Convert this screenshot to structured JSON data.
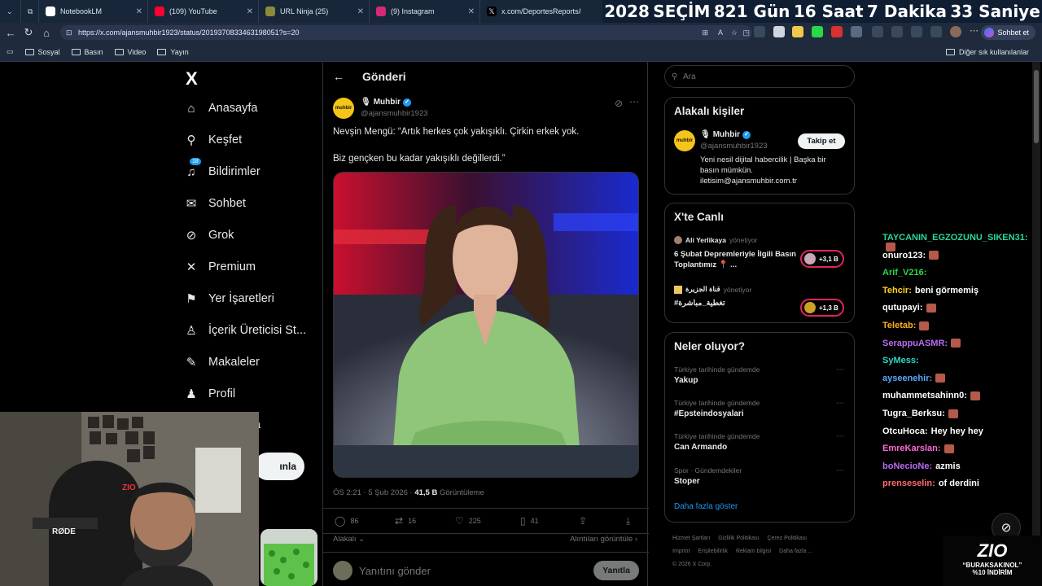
{
  "browser": {
    "tabs": [
      {
        "title": "NotebookLM",
        "color": "#ffffff"
      },
      {
        "title": "(109) YouTube",
        "color": "#ff0033"
      },
      {
        "title": "URL Ninja (25)",
        "color": "#8a8a3a"
      },
      {
        "title": "(9) Instagram",
        "color": "#d62976"
      },
      {
        "title": "x.com/DeportesReports/sta",
        "color": "#000000"
      }
    ],
    "url": "https://x.com/ajansmuhbir1923/status/2019370833463198051?s=20",
    "chat_button": "Sohbet et",
    "bookmarks": [
      "Sosyal",
      "Basın",
      "Video",
      "Yayın"
    ],
    "other_bookmarks": "Diğer sık kullanılanlar"
  },
  "countdown": {
    "year": "2028",
    "label": "SEÇİM",
    "days": "821 Gün",
    "hours": "16 Saat",
    "minutes": "7 Dakika",
    "seconds": "33 Saniye"
  },
  "sidebar": {
    "logo": "X",
    "items": [
      {
        "label": "Anasayfa",
        "icon": "home-icon"
      },
      {
        "label": "Keşfet",
        "icon": "search-icon"
      },
      {
        "label": "Bildirimler",
        "icon": "bell-icon",
        "badge": "18"
      },
      {
        "label": "Sohbet",
        "icon": "mail-icon"
      },
      {
        "label": "Grok",
        "icon": "grok-icon"
      },
      {
        "label": "Premium",
        "icon": "x-icon"
      },
      {
        "label": "Yer İşaretleri",
        "icon": "bookmark-icon"
      },
      {
        "label": "İçerik Üreticisi St...",
        "icon": "creator-icon"
      },
      {
        "label": "Makaleler",
        "icon": "article-icon"
      },
      {
        "label": "Profil",
        "icon": "person-icon"
      }
    ],
    "post_button": "ınla",
    "partial_item": "a"
  },
  "post": {
    "header": "Gönderi",
    "author_name": "Muhbir",
    "author_handle": "@ajansmuhbir1923",
    "avatar_text": "muhbir",
    "text_line1": "Nevşin Mengü: “Artık herkes çok yakışıklı. Çirkin erkek yok.",
    "text_line2": "Biz gençken bu kadar yakışıklı değillerdi.”",
    "timestamp": "ÖS 2:21 · 5 Şub 2026 ·",
    "views_count": "41,5 B",
    "views_label": "Görüntüleme",
    "replies": "86",
    "reposts": "16",
    "likes": "225",
    "bookmarks": "41",
    "related_label": "Alakalı",
    "quotes_label": "Alıntıları görüntüle",
    "reply_placeholder": "Yanıtını gönder",
    "reply_button": "Yanıtla"
  },
  "right": {
    "search_placeholder": "Ara",
    "relevant_title": "Alakalı kişiler",
    "relevant_name": "Muhbir",
    "relevant_handle": "@ajansmuhbir1923",
    "follow_button": "Takip et",
    "bio": "Yeni nesil dijital habercilik | Başka bir basın mümkün. iletisim@ajansmuhbir.com.tr",
    "live_title": "X'te Canlı",
    "live": [
      {
        "host": "Ali Yerlikaya",
        "role": "yönetiyor",
        "title": "6 Şubat Depremleriyle İlgili Basın Toplantımız 📍 ...",
        "count": "+3,1 B"
      },
      {
        "host": "قناة الجزيرة",
        "role": "yönetiyor",
        "title": "#تغطية_مباشرة",
        "count": "+1,3 B"
      }
    ],
    "trends_title": "Neler oluyor?",
    "trends": [
      {
        "category": "Türkiye tarihinde gündemde",
        "name": "Yakup"
      },
      {
        "category": "Türkiye tarihinde gündemde",
        "name": "#Epsteindosyalari"
      },
      {
        "category": "Türkiye tarihinde gündemde",
        "name": "Can Armando"
      },
      {
        "category": "Spor · Gündemdekiler",
        "name": "Stoper"
      }
    ],
    "show_more": "Daha fazla göster",
    "footer": [
      "Hizmet Şartları",
      "Gizlilik Politikası",
      "Çerez Politikası",
      "Imprint",
      "Erişilebilirlik",
      "Reklam bilgisi",
      "Daha fazla ...",
      "© 2026 X Corp."
    ]
  },
  "chat": [
    {
      "user": "TAYCANIN_EGZOZUNU_SIKEN31:",
      "msg": "",
      "color": "#29d89a"
    },
    {
      "user": "onuro123:",
      "msg": "",
      "color": "#ffffff"
    },
    {
      "user": "Arif_V216:",
      "msg": "",
      "color": "#29d84a"
    },
    {
      "user": "Tehcir:",
      "msg": "beni görmemiş",
      "color": "#ffd21f"
    },
    {
      "user": "qutupayi:",
      "msg": "",
      "color": "#ffffff"
    },
    {
      "user": "Teletab:",
      "msg": "",
      "color": "#ffb020"
    },
    {
      "user": "SerappuASMR:",
      "msg": "",
      "color": "#b86cf0"
    },
    {
      "user": "SyMess:",
      "msg": "",
      "color": "#29d8c8"
    },
    {
      "user": "ayseenehir:",
      "msg": "",
      "color": "#5aa8ff"
    },
    {
      "user": "muhammetsahinn0:",
      "msg": "",
      "color": "#ffffff"
    },
    {
      "user": "Tugra_Berksu:",
      "msg": "",
      "color": "#ffffff"
    },
    {
      "user": "OtcuHoca:",
      "msg": "Hey hey hey",
      "color": "#ffffff"
    },
    {
      "user": "EmreKarslan:",
      "msg": "",
      "color": "#ff6ad5"
    },
    {
      "user": "boNecioNe:",
      "msg": "azmis",
      "color": "#b86cf0"
    },
    {
      "user": "prenseselin:",
      "msg": "of derdini",
      "color": "#ff6a6a"
    }
  ],
  "overlay": {
    "promo_brand": "ZIO",
    "promo_code": "“BURAKSAKINOL”",
    "promo_discount": "%10 İNDİRİM",
    "mic_label": "RØDE"
  }
}
